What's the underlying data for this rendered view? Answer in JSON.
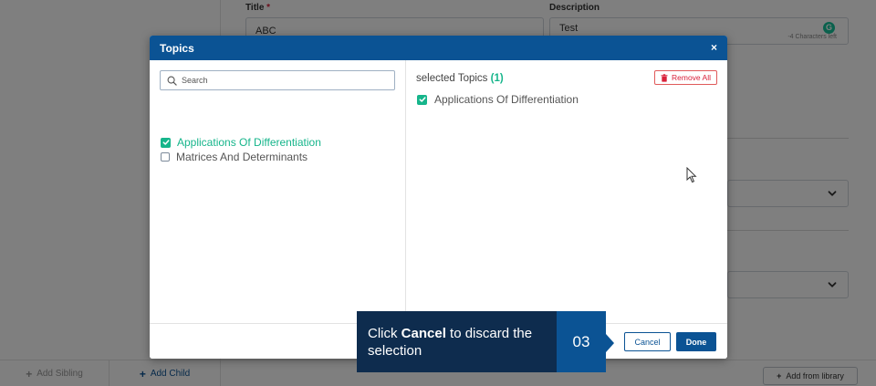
{
  "background": {
    "title_label": "Title",
    "title_required": "*",
    "title_value": "ABC",
    "description_label": "Description",
    "description_value": "Test",
    "chars_left": "-4 Characters left",
    "grammarly_letter": "G",
    "add_sibling": "Add Sibling",
    "add_child": "Add Child",
    "add_from_library": "Add from library"
  },
  "modal": {
    "title": "Topics",
    "close_symbol": "×",
    "search_placeholder": "Search",
    "options": [
      {
        "label": "Applications Of Differentiation",
        "checked": true
      },
      {
        "label": "Matrices And Determinants",
        "checked": false
      }
    ],
    "selected_label": "selected Topics",
    "selected_count": "(1)",
    "remove_all": "Remove All",
    "selected_items": [
      {
        "label": "Applications Of Differentiation"
      }
    ],
    "cancel": "Cancel",
    "done": "Done"
  },
  "tooltip": {
    "prefix": "Click ",
    "bold": "Cancel",
    "suffix": " to discard the selection",
    "step": "03"
  },
  "colors": {
    "primary": "#0b5394",
    "accent_green": "#16b58b",
    "danger": "#d9213a",
    "tooltip_bg": "#0e2c4e"
  },
  "icons": [
    "search-icon",
    "check-icon",
    "trash-icon",
    "close-icon",
    "plus-icon",
    "chevron-down-icon",
    "grammarly-icon",
    "cursor-icon"
  ]
}
